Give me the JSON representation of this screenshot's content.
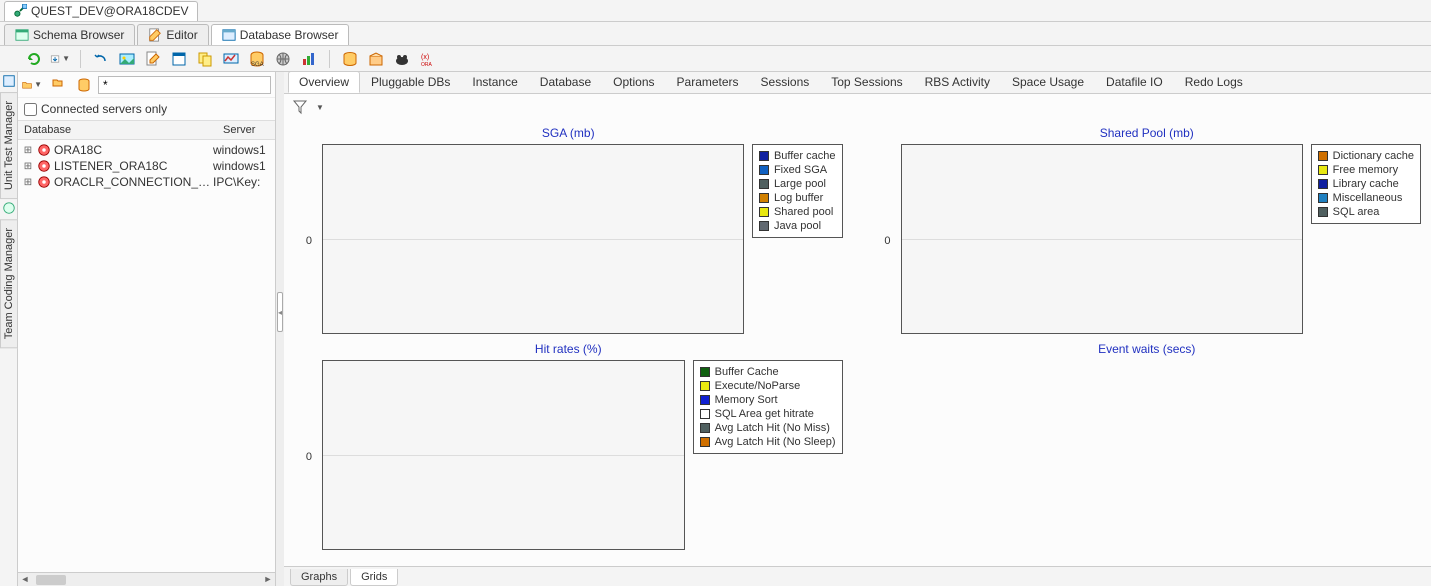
{
  "connection_tab": "QUEST_DEV@ORA18CDEV",
  "main_tabs": [
    {
      "label": "Schema Browser",
      "active": false
    },
    {
      "label": "Editor",
      "active": false
    },
    {
      "label": "Database Browser",
      "active": true
    }
  ],
  "vtabs": [
    "Unit Test Manager",
    "Team Coding Manager"
  ],
  "sidebar": {
    "filter_value": "*",
    "connected_only_label": "Connected servers only",
    "headers": {
      "db": "Database",
      "srv": "Server"
    },
    "nodes": [
      {
        "label": "ORA18C",
        "server": "windows1"
      },
      {
        "label": "LISTENER_ORA18C",
        "server": "windows1"
      },
      {
        "label": "ORACLR_CONNECTION_DATA",
        "server": "IPC\\Key:"
      }
    ]
  },
  "sub_tabs": [
    "Overview",
    "Pluggable DBs",
    "Instance",
    "Database",
    "Options",
    "Parameters",
    "Sessions",
    "Top Sessions",
    "RBS Activity",
    "Space Usage",
    "Datafile IO",
    "Redo Logs"
  ],
  "sub_tabs_active": "Overview",
  "charts": {
    "sga": {
      "title": "SGA (mb)",
      "ytick": "0",
      "legend": [
        {
          "label": "Buffer cache",
          "color": "#1020a0"
        },
        {
          "label": "Fixed SGA",
          "color": "#1060c0"
        },
        {
          "label": "Large pool",
          "color": "#506060"
        },
        {
          "label": "Log buffer",
          "color": "#d08000"
        },
        {
          "label": "Shared pool",
          "color": "#e8e810"
        },
        {
          "label": "Java pool",
          "color": "#606870"
        }
      ]
    },
    "shared_pool": {
      "title": "Shared Pool (mb)",
      "ytick": "0",
      "legend": [
        {
          "label": "Dictionary cache",
          "color": "#d07000"
        },
        {
          "label": "Free memory",
          "color": "#e8e810"
        },
        {
          "label": "Library cache",
          "color": "#1020a0"
        },
        {
          "label": "Miscellaneous",
          "color": "#2080c0"
        },
        {
          "label": "SQL area",
          "color": "#506060"
        }
      ]
    },
    "hit_rates": {
      "title": "Hit rates (%)",
      "ytick": "0",
      "legend": [
        {
          "label": "Buffer Cache",
          "color": "#106010"
        },
        {
          "label": "Execute/NoParse",
          "color": "#e8e810"
        },
        {
          "label": "Memory Sort",
          "color": "#1020d0"
        },
        {
          "label": "SQL Area get hitrate",
          "color": "#ffffff"
        },
        {
          "label": "Avg Latch Hit (No Miss)",
          "color": "#506060"
        },
        {
          "label": "Avg Latch Hit (No Sleep)",
          "color": "#d07000"
        }
      ]
    },
    "event_waits": {
      "title": "Event waits (secs)",
      "ytick": "",
      "legend": []
    }
  },
  "bottom_tabs": {
    "items": [
      "Graphs",
      "Grids"
    ],
    "active": "Grids"
  },
  "chart_data": [
    {
      "type": "line",
      "title": "SGA (mb)",
      "series": [
        {
          "name": "Buffer cache",
          "values": []
        },
        {
          "name": "Fixed SGA",
          "values": []
        },
        {
          "name": "Large pool",
          "values": []
        },
        {
          "name": "Log buffer",
          "values": []
        },
        {
          "name": "Shared pool",
          "values": []
        },
        {
          "name": "Java pool",
          "values": []
        }
      ],
      "ylim": [
        0,
        0
      ]
    },
    {
      "type": "line",
      "title": "Shared Pool (mb)",
      "series": [
        {
          "name": "Dictionary cache",
          "values": []
        },
        {
          "name": "Free memory",
          "values": []
        },
        {
          "name": "Library cache",
          "values": []
        },
        {
          "name": "Miscellaneous",
          "values": []
        },
        {
          "name": "SQL area",
          "values": []
        }
      ],
      "ylim": [
        0,
        0
      ]
    },
    {
      "type": "line",
      "title": "Hit rates (%)",
      "series": [
        {
          "name": "Buffer Cache",
          "values": []
        },
        {
          "name": "Execute/NoParse",
          "values": []
        },
        {
          "name": "Memory Sort",
          "values": []
        },
        {
          "name": "SQL Area get hitrate",
          "values": []
        },
        {
          "name": "Avg Latch Hit (No Miss)",
          "values": []
        },
        {
          "name": "Avg Latch Hit (No Sleep)",
          "values": []
        }
      ],
      "ylim": [
        0,
        0
      ]
    },
    {
      "type": "line",
      "title": "Event waits (secs)",
      "series": [],
      "ylim": [
        0,
        0
      ]
    }
  ]
}
